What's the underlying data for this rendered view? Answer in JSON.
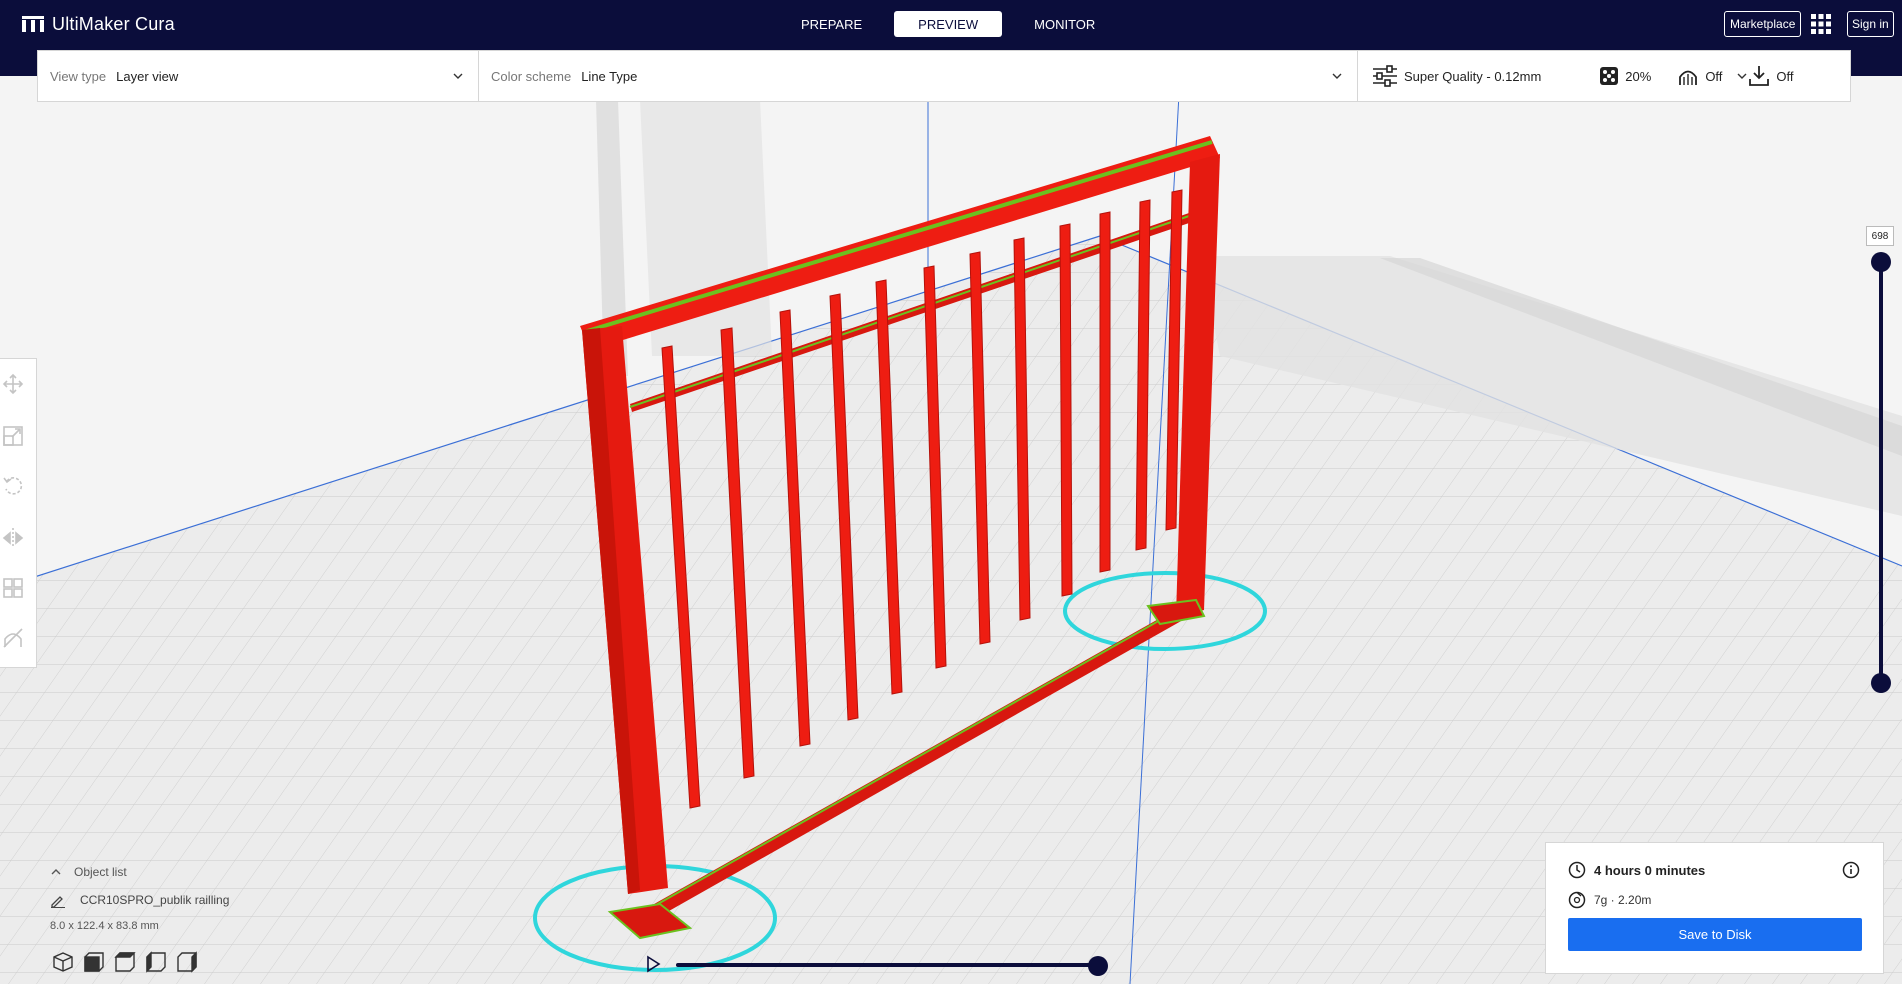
{
  "app": {
    "name": "UltiMaker Cura"
  },
  "header": {
    "tabs": [
      {
        "label": "PREPARE",
        "active": false
      },
      {
        "label": "PREVIEW",
        "active": true
      },
      {
        "label": "MONITOR",
        "active": false
      }
    ],
    "marketplace_label": "Marketplace",
    "signin_label": "Sign in"
  },
  "view_settings": {
    "view_type_label": "View type",
    "view_type_value": "Layer view",
    "color_scheme_label": "Color scheme",
    "color_scheme_value": "Line Type"
  },
  "print_setup": {
    "profile": "Super Quality - 0.12mm",
    "infill": "20%",
    "support": "Off",
    "adhesion": "Off"
  },
  "layer_slider": {
    "current_layer": "698",
    "level": 1.0
  },
  "object_list": {
    "header_label": "Object list",
    "object_name": "CCR10SPRO_publik railling",
    "dimensions": "8.0 x 122.4 x 83.8 mm"
  },
  "simulation": {
    "progress": 1.0
  },
  "job": {
    "print_time": "4 hours 0 minutes",
    "material": "7g · 2.20m",
    "save_label": "Save to Disk"
  },
  "colors": {
    "header_bg": "#0b0d3b",
    "accent": "#196ef0",
    "wall_red": "#ee1d12",
    "infill_green": "#6cc11f",
    "skirt_cyan": "#2fd6dc"
  },
  "icons": {
    "brand": "ultimaker-logo-icon",
    "apps": "apps-grid-icon",
    "profile": "sliders-icon",
    "infill": "infill-icon",
    "support": "support-icon",
    "adhesion": "adhesion-icon"
  }
}
